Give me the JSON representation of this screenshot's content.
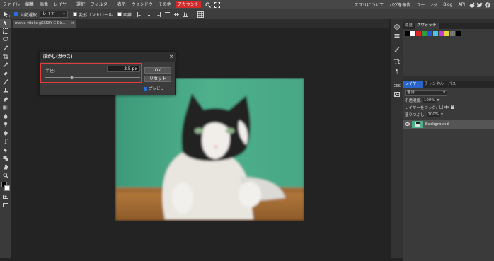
{
  "menu": {
    "items": [
      "ファイル",
      "編集",
      "画像",
      "レイヤー",
      "選択",
      "フィルター",
      "表示",
      "ウインドウ",
      "その他"
    ],
    "account": "アカウント",
    "right_links": [
      "アプリについて",
      "バグを報告",
      "ラーニング",
      "Blog",
      "API"
    ]
  },
  "options": {
    "auto_select": "自動選択",
    "layer_select": "レイヤー",
    "transform_controls": "変形コントロール",
    "distances": "距離"
  },
  "document": {
    "tab_name": "manja-vitolic-gKXKBY-C-Dk...",
    "close": "×"
  },
  "dialog": {
    "title": "ぼかし(ガウス)",
    "close": "×",
    "radius_label": "半径:",
    "radius_value": "3.5 px",
    "radius_fraction": 0.2,
    "ok": "OK",
    "reset": "リセット",
    "preview": "プレビュー",
    "preview_checked": true
  },
  "swatches_panel": {
    "tabs": [
      "履歴",
      "スウォッチ"
    ],
    "active_tab": "スウォッチ",
    "colors": [
      "#000000",
      "#ffffff",
      "#e02424",
      "#2f9e3a",
      "#2b55d9",
      "#46c7e8",
      "#c03fcc",
      "#e8d53a",
      "#777777",
      "#000000"
    ]
  },
  "layers_panel": {
    "tabs": [
      "レイヤー",
      "チャンネル",
      "パス"
    ],
    "blend_mode": "通常",
    "opacity_label": "不透明度:",
    "opacity_value": "100%",
    "lock_label": "レイヤーをロック:",
    "fill_label": "塗りつぶし:",
    "fill_value": "100%",
    "layer_name": "Background"
  }
}
